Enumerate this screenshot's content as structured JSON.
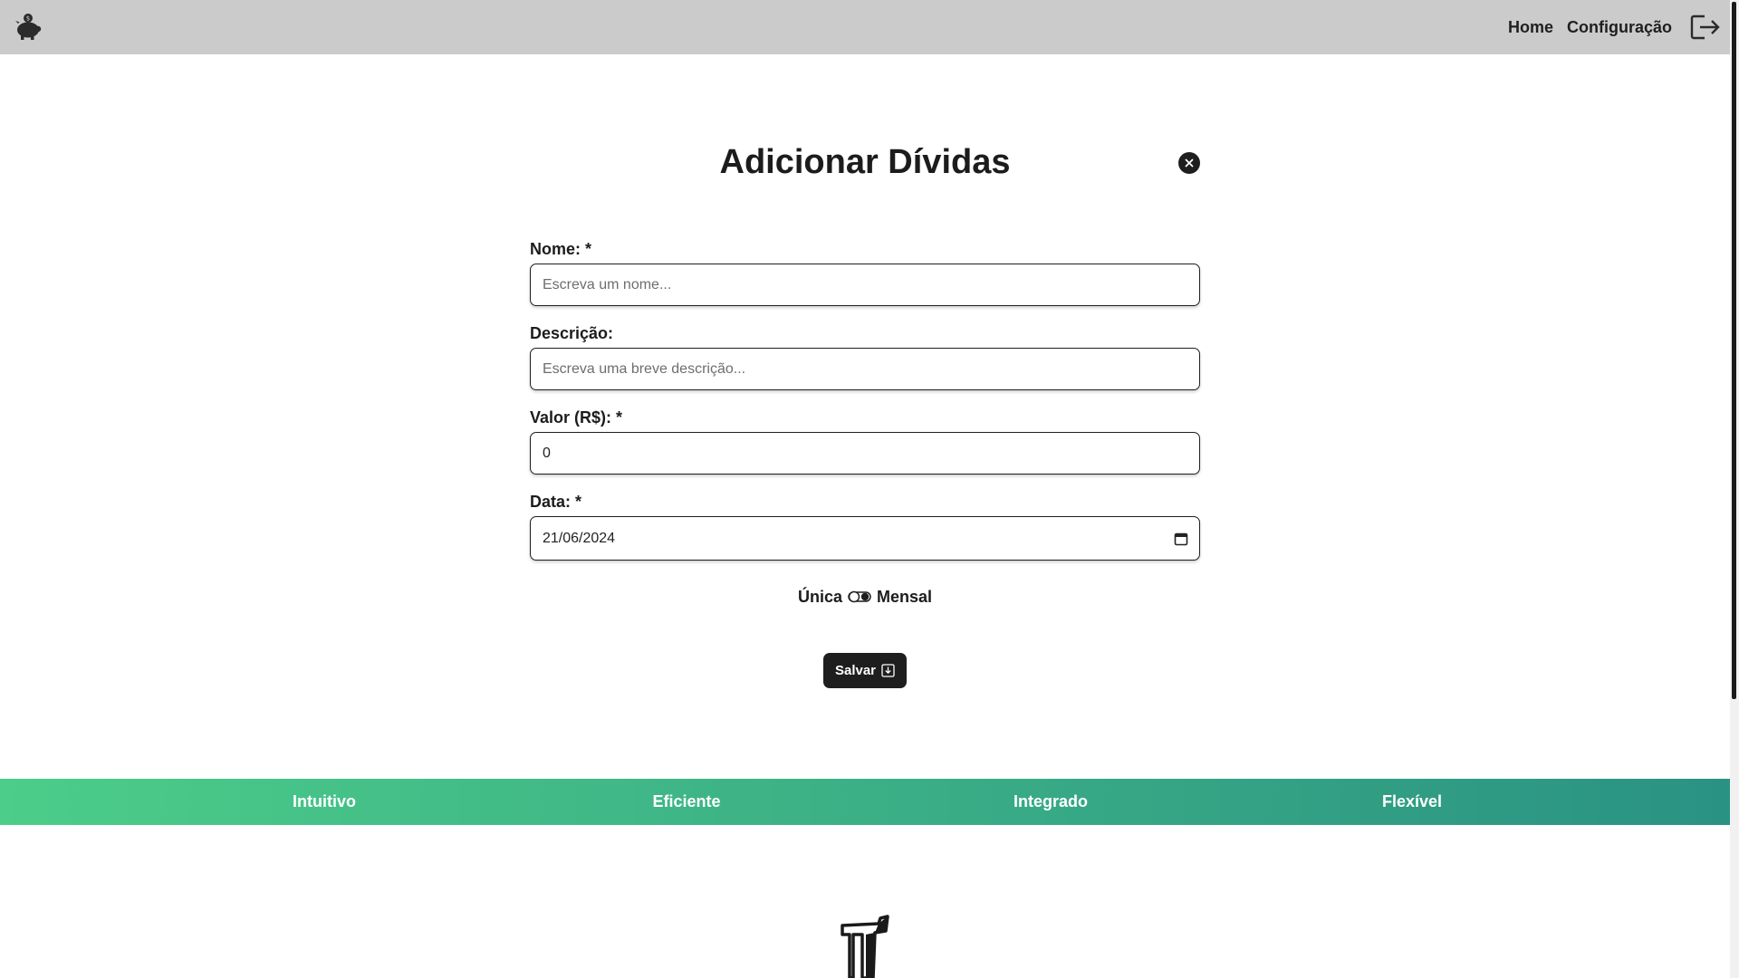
{
  "navbar": {
    "logo_icon": "piggy-bank-icon",
    "links": [
      "Home",
      "Configuração"
    ],
    "logout_icon": "logout-icon",
    "background": "#cbcbcb"
  },
  "form": {
    "title": "Adicionar Dívidas",
    "close_icon": "close-circle-icon",
    "fields": {
      "nome": {
        "label": "Nome: *",
        "placeholder": "Escreva um nome...",
        "value": ""
      },
      "descricao": {
        "label": "Descrição:",
        "placeholder": "Escreva uma breve descrição...",
        "value": ""
      },
      "valor": {
        "label": "Valor (R$): *",
        "value": "0"
      },
      "data": {
        "label": "Data: *",
        "value": "21/06/2024",
        "icon": "calendar-icon"
      }
    },
    "recurrence": {
      "left_label": "Única",
      "right_label": "Mensal",
      "selected": "Mensal"
    },
    "save_button": {
      "label": "Salvar",
      "icon": "save-icon"
    }
  },
  "features": {
    "items": [
      "Intuitivo",
      "Eficiente",
      "Integrado",
      "Flexível"
    ],
    "gradient_start": "#4ccd89",
    "gradient_end": "#2a9283"
  },
  "footer": {
    "logo_icon": "brand-logo-icon"
  }
}
